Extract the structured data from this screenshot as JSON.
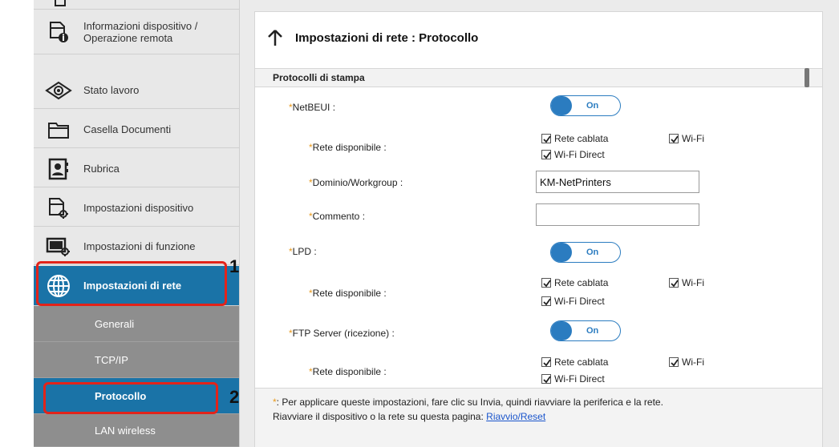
{
  "sidebar": {
    "items": [
      {
        "label": "Informazioni dispositivo / Operazione remota",
        "icon": "device-info-icon"
      },
      {
        "label": "Stato lavoro",
        "icon": "eye-icon"
      },
      {
        "label": "Casella Documenti",
        "icon": "folder-icon"
      },
      {
        "label": "Rubrica",
        "icon": "address-book-icon"
      },
      {
        "label": "Impostazioni dispositivo",
        "icon": "device-settings-icon"
      },
      {
        "label": "Impostazioni di funzione",
        "icon": "function-settings-icon"
      },
      {
        "label": "Impostazioni di rete",
        "icon": "globe-icon"
      }
    ],
    "sub_items": [
      {
        "label": "Generali"
      },
      {
        "label": "TCP/IP"
      },
      {
        "label": "Protocollo"
      },
      {
        "label": "LAN wireless"
      }
    ]
  },
  "callouts": [
    "1",
    "2"
  ],
  "page": {
    "title": "Impostazioni di rete : Protocollo",
    "section": "Protocolli di stampa"
  },
  "form": {
    "asterisk": "*",
    "netbeui_label": "NetBEUI :",
    "toggle_on": "On",
    "available_network": "Rete disponibile :",
    "wired": "Rete cablata",
    "wifi": "Wi-Fi",
    "wifi_direct": "Wi-Fi Direct",
    "domain_label": "Dominio/Workgroup :",
    "domain_value": "KM-NetPrinters",
    "comment_label": "Commento :",
    "comment_value": "",
    "lpd_label": "LPD :",
    "ftp_label": "FTP Server (ricezione) :"
  },
  "footer": {
    "asterisk": "*",
    "note": ": Per applicare queste impostazioni, fare clic su Invia, quindi riavviare la periferica e la rete.",
    "restart_text": "Riavviare il dispositivo o la rete su questa pagina:",
    "restart_link": "Riavvio/Reset"
  },
  "colors": {
    "accent": "#1a73a7",
    "toggle": "#2b7cc0",
    "callout": "#e2231a",
    "asterisk": "#e89a1e"
  }
}
